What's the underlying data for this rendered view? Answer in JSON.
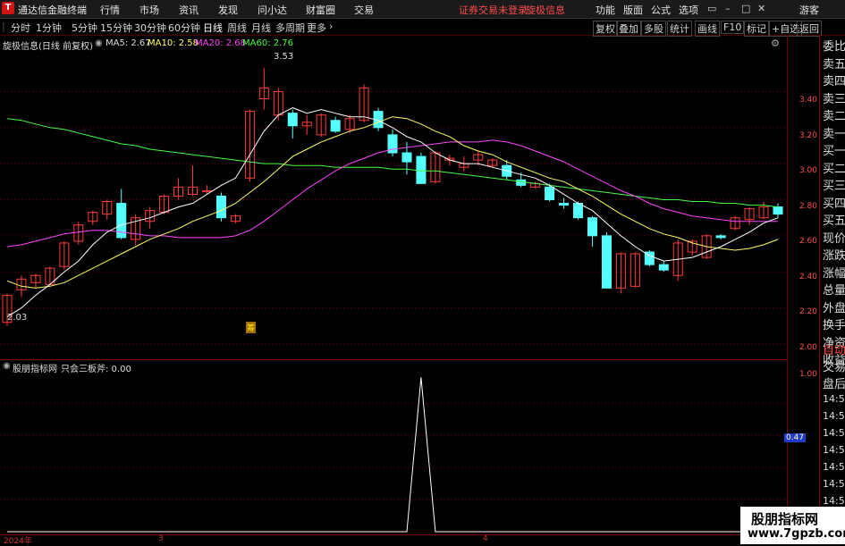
{
  "app": {
    "title": "通达信金融终端",
    "logo": "T",
    "menu": [
      "行情",
      "市场",
      "资讯",
      "发现",
      "问小达",
      "财富圈",
      "交易"
    ],
    "warning": "证券交易未登录",
    "stock_name": "旋极信息",
    "right_menu": [
      "功能",
      "版面",
      "公式",
      "选项"
    ],
    "user": "游客"
  },
  "toolbar": {
    "periods": [
      "分时",
      "1分钟",
      "5分钟",
      "15分钟",
      "30分钟",
      "60分钟",
      "日线",
      "周线",
      "月线",
      "多周期",
      "更多"
    ],
    "active_period": "日线",
    "right_buttons": [
      "复权",
      "叠加",
      "多股",
      "统计",
      "画线",
      "F10",
      "标记",
      "+自选",
      "返回"
    ]
  },
  "chart_header": {
    "title": "旋极信息(日线 前复权)",
    "ma": [
      {
        "label": "MA5: 2.67",
        "color": "#ffffff"
      },
      {
        "label": "MA10: 2.58",
        "color": "#ffff66"
      },
      {
        "label": "MA20: 2.68",
        "color": "#ff44ff"
      },
      {
        "label": "MA60: 2.76",
        "color": "#44ff44"
      }
    ]
  },
  "price_axis": [
    "3.40",
    "3.20",
    "3.00",
    "2.80",
    "2.60",
    "2.40",
    "2.20",
    "2.00"
  ],
  "high_marker": "3.53",
  "low_marker": "2.03",
  "event_marker": "筹",
  "indicator": {
    "title": "股朋指标网",
    "formula": "只会三板斧: 0.00",
    "axis": [
      "1.00",
      "0.47"
    ],
    "axis_highlight": "0.47"
  },
  "dates": [
    "2024年",
    "3",
    "4"
  ],
  "right_panel": {
    "items": [
      "委比",
      "卖五",
      "卖四",
      "卖三",
      "卖二",
      "卖一",
      "买一",
      "买二",
      "买三",
      "买四",
      "买五",
      "现价",
      "涨跌",
      "涨幅",
      "总量",
      "外盘",
      "换手",
      "净资",
      "收益"
    ],
    "tabs": [
      "自动",
      "交易",
      "盘后"
    ],
    "times": [
      "14:5",
      "14:5",
      "14:5",
      "14:5",
      "14:5",
      "14:5",
      "14:5",
      "14:5"
    ]
  },
  "watermark": {
    "line1": "股朋指标网",
    "line2": "www.7gpzb.com"
  },
  "colors": {
    "up": "#ff3c3c",
    "down": "#54ffff",
    "ma5": "#ffffff",
    "ma10": "#ffff66",
    "ma20": "#ff44ff",
    "ma60": "#44ff44",
    "grid": "#7a0000"
  },
  "chart_data": {
    "type": "candlestick",
    "y_range": [
      1.95,
      3.65
    ],
    "candles": [
      {
        "o": 2.12,
        "h": 2.28,
        "l": 2.1,
        "c": 2.27
      },
      {
        "o": 2.3,
        "h": 2.38,
        "l": 2.26,
        "c": 2.36
      },
      {
        "o": 2.34,
        "h": 2.39,
        "l": 2.31,
        "c": 2.38
      },
      {
        "o": 2.33,
        "h": 2.43,
        "l": 2.33,
        "c": 2.42
      },
      {
        "o": 2.43,
        "h": 2.57,
        "l": 2.41,
        "c": 2.56
      },
      {
        "o": 2.57,
        "h": 2.68,
        "l": 2.55,
        "c": 2.66
      },
      {
        "o": 2.68,
        "h": 2.74,
        "l": 2.66,
        "c": 2.73
      },
      {
        "o": 2.72,
        "h": 2.8,
        "l": 2.69,
        "c": 2.79
      },
      {
        "o": 2.78,
        "h": 2.86,
        "l": 2.58,
        "c": 2.59
      },
      {
        "o": 2.58,
        "h": 2.72,
        "l": 2.55,
        "c": 2.7
      },
      {
        "o": 2.68,
        "h": 2.76,
        "l": 2.64,
        "c": 2.74
      },
      {
        "o": 2.73,
        "h": 2.83,
        "l": 2.72,
        "c": 2.82
      },
      {
        "o": 2.82,
        "h": 2.92,
        "l": 2.8,
        "c": 2.87
      },
      {
        "o": 2.83,
        "h": 2.99,
        "l": 2.82,
        "c": 2.87
      },
      {
        "o": 2.85,
        "h": 2.88,
        "l": 2.83,
        "c": 2.85
      },
      {
        "o": 2.82,
        "h": 2.84,
        "l": 2.68,
        "c": 2.7
      },
      {
        "o": 2.68,
        "h": 2.72,
        "l": 2.67,
        "c": 2.71
      },
      {
        "o": 2.92,
        "h": 3.3,
        "l": 2.9,
        "c": 3.29
      },
      {
        "o": 3.36,
        "h": 3.53,
        "l": 3.3,
        "c": 3.42
      },
      {
        "o": 3.27,
        "h": 3.42,
        "l": 3.24,
        "c": 3.4
      },
      {
        "o": 3.28,
        "h": 3.3,
        "l": 3.14,
        "c": 3.21
      },
      {
        "o": 3.21,
        "h": 3.27,
        "l": 3.16,
        "c": 3.23
      },
      {
        "o": 3.16,
        "h": 3.28,
        "l": 3.15,
        "c": 3.27
      },
      {
        "o": 3.24,
        "h": 3.26,
        "l": 3.17,
        "c": 3.18
      },
      {
        "o": 3.19,
        "h": 3.27,
        "l": 3.17,
        "c": 3.25
      },
      {
        "o": 3.24,
        "h": 3.44,
        "l": 3.23,
        "c": 3.42
      },
      {
        "o": 3.29,
        "h": 3.31,
        "l": 3.18,
        "c": 3.2
      },
      {
        "o": 3.16,
        "h": 3.19,
        "l": 3.04,
        "c": 3.06
      },
      {
        "o": 3.06,
        "h": 3.12,
        "l": 2.94,
        "c": 3.01
      },
      {
        "o": 3.04,
        "h": 3.06,
        "l": 2.89,
        "c": 2.89
      },
      {
        "o": 2.9,
        "h": 3.07,
        "l": 2.89,
        "c": 3.06
      },
      {
        "o": 3.02,
        "h": 3.05,
        "l": 2.99,
        "c": 3.03
      },
      {
        "o": 2.98,
        "h": 3.04,
        "l": 2.96,
        "c": 3.0
      },
      {
        "o": 3.02,
        "h": 3.07,
        "l": 2.99,
        "c": 3.05
      },
      {
        "o": 2.99,
        "h": 3.03,
        "l": 2.98,
        "c": 3.02
      },
      {
        "o": 2.99,
        "h": 3.02,
        "l": 2.91,
        "c": 2.93
      },
      {
        "o": 2.91,
        "h": 2.95,
        "l": 2.87,
        "c": 2.88
      },
      {
        "o": 2.87,
        "h": 2.9,
        "l": 2.86,
        "c": 2.89
      },
      {
        "o": 2.87,
        "h": 2.89,
        "l": 2.79,
        "c": 2.8
      },
      {
        "o": 2.78,
        "h": 2.81,
        "l": 2.75,
        "c": 2.77
      },
      {
        "o": 2.78,
        "h": 2.79,
        "l": 2.69,
        "c": 2.7
      },
      {
        "o": 2.7,
        "h": 2.71,
        "l": 2.54,
        "c": 2.6
      },
      {
        "o": 2.6,
        "h": 2.62,
        "l": 2.31,
        "c": 2.31
      },
      {
        "o": 2.31,
        "h": 2.51,
        "l": 2.28,
        "c": 2.5
      },
      {
        "o": 2.32,
        "h": 2.51,
        "l": 2.31,
        "c": 2.5
      },
      {
        "o": 2.51,
        "h": 2.52,
        "l": 2.43,
        "c": 2.44
      },
      {
        "o": 2.44,
        "h": 2.46,
        "l": 2.4,
        "c": 2.41
      },
      {
        "o": 2.38,
        "h": 2.58,
        "l": 2.35,
        "c": 2.56
      },
      {
        "o": 2.51,
        "h": 2.58,
        "l": 2.49,
        "c": 2.57
      },
      {
        "o": 2.48,
        "h": 2.61,
        "l": 2.47,
        "c": 2.6
      },
      {
        "o": 2.6,
        "h": 2.61,
        "l": 2.58,
        "c": 2.59
      },
      {
        "o": 2.64,
        "h": 2.71,
        "l": 2.63,
        "c": 2.7
      },
      {
        "o": 2.69,
        "h": 2.76,
        "l": 2.66,
        "c": 2.75
      },
      {
        "o": 2.7,
        "h": 2.79,
        "l": 2.69,
        "c": 2.76
      },
      {
        "o": 2.76,
        "h": 2.78,
        "l": 2.7,
        "c": 2.72
      }
    ],
    "ma5": [
      2.15,
      2.2,
      2.27,
      2.33,
      2.4,
      2.46,
      2.55,
      2.62,
      2.66,
      2.68,
      2.7,
      2.73,
      2.76,
      2.78,
      2.83,
      2.88,
      2.92,
      3.05,
      3.18,
      3.27,
      3.31,
      3.28,
      3.3,
      3.28,
      3.26,
      3.26,
      3.24,
      3.2,
      3.15,
      3.12,
      3.06,
      3.02,
      3.0,
      3.0,
      2.98,
      2.96,
      2.94,
      2.92,
      2.88,
      2.83,
      2.78,
      2.74,
      2.67,
      2.6,
      2.54,
      2.49,
      2.46,
      2.47,
      2.48,
      2.51,
      2.54,
      2.58,
      2.62,
      2.67,
      2.7
    ],
    "ma10": [
      2.35,
      2.32,
      2.31,
      2.32,
      2.34,
      2.38,
      2.42,
      2.46,
      2.5,
      2.54,
      2.58,
      2.61,
      2.64,
      2.68,
      2.71,
      2.74,
      2.78,
      2.84,
      2.9,
      2.97,
      3.04,
      3.08,
      3.12,
      3.15,
      3.18,
      3.2,
      3.23,
      3.26,
      3.25,
      3.22,
      3.18,
      3.15,
      3.1,
      3.07,
      3.05,
      3.01,
      2.98,
      2.95,
      2.92,
      2.9,
      2.86,
      2.82,
      2.77,
      2.72,
      2.68,
      2.64,
      2.61,
      2.59,
      2.56,
      2.54,
      2.53,
      2.52,
      2.53,
      2.55,
      2.58
    ],
    "ma20": [
      2.54,
      2.55,
      2.57,
      2.59,
      2.61,
      2.62,
      2.63,
      2.63,
      2.62,
      2.61,
      2.6,
      2.6,
      2.59,
      2.59,
      2.59,
      2.59,
      2.6,
      2.63,
      2.68,
      2.74,
      2.8,
      2.86,
      2.91,
      2.96,
      3.0,
      3.03,
      3.06,
      3.08,
      3.09,
      3.1,
      3.11,
      3.12,
      3.12,
      3.12,
      3.13,
      3.12,
      3.1,
      3.07,
      3.04,
      3.01,
      2.97,
      2.93,
      2.89,
      2.85,
      2.82,
      2.78,
      2.75,
      2.73,
      2.71,
      2.7,
      2.69,
      2.68,
      2.68,
      2.68,
      2.68
    ],
    "ma60": [
      3.25,
      3.24,
      3.22,
      3.2,
      3.19,
      3.17,
      3.15,
      3.13,
      3.11,
      3.1,
      3.08,
      3.07,
      3.06,
      3.05,
      3.04,
      3.03,
      3.02,
      3.01,
      3.0,
      3.0,
      2.99,
      2.99,
      2.99,
      2.98,
      2.98,
      2.98,
      2.98,
      2.97,
      2.97,
      2.96,
      2.96,
      2.95,
      2.94,
      2.93,
      2.92,
      2.91,
      2.9,
      2.89,
      2.88,
      2.87,
      2.86,
      2.85,
      2.84,
      2.83,
      2.82,
      2.81,
      2.8,
      2.8,
      2.79,
      2.79,
      2.78,
      2.78,
      2.77,
      2.77,
      2.76
    ],
    "indicator_values": [
      0,
      0,
      0,
      0,
      0,
      0,
      0,
      0,
      0,
      0,
      0,
      0,
      0,
      0,
      0,
      0,
      0,
      0,
      0,
      0,
      0,
      0,
      0,
      0,
      0,
      0,
      0,
      0,
      0,
      1,
      0,
      0,
      0,
      0,
      0,
      0,
      0,
      0,
      0,
      0,
      0,
      0,
      0,
      0,
      0,
      0,
      0,
      0,
      0,
      0,
      0,
      0,
      0,
      0,
      0
    ]
  }
}
